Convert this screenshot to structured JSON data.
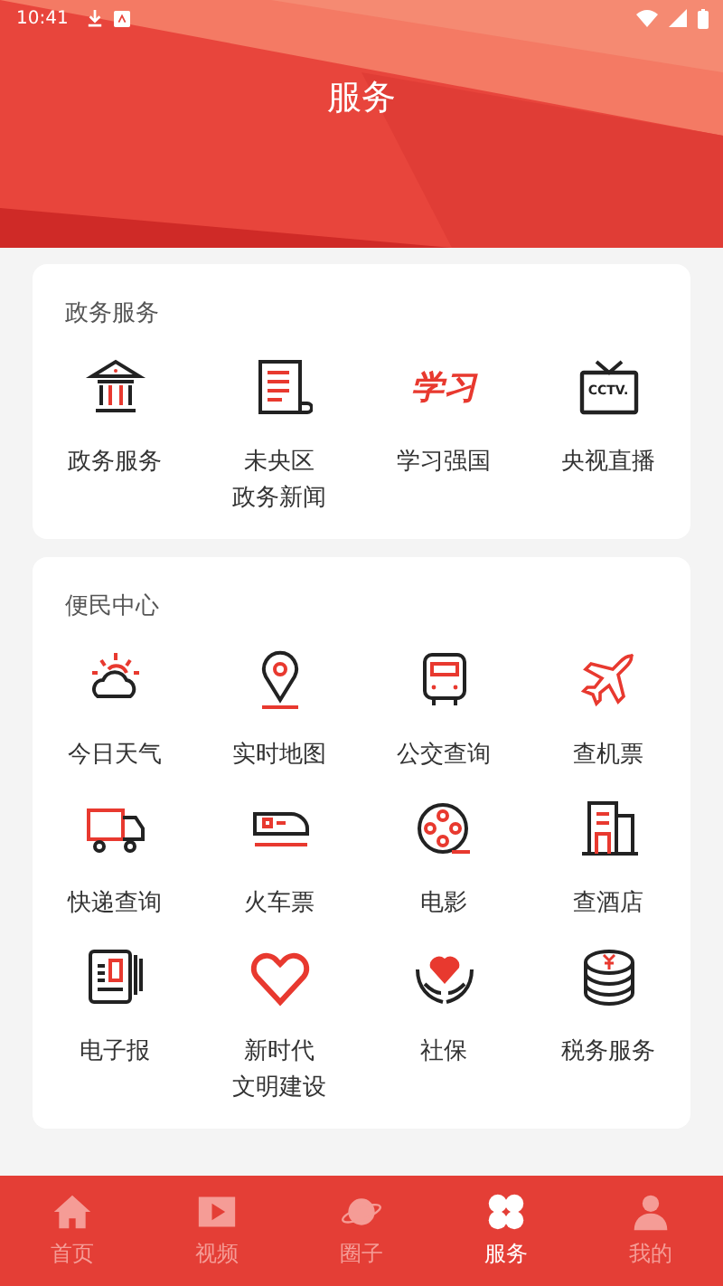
{
  "status_bar": {
    "time": "10:41"
  },
  "header": {
    "title": "服务"
  },
  "sections": [
    {
      "title": "政务服务",
      "items": [
        {
          "label": "政务服务"
        },
        {
          "label": "未央区",
          "label_line_2": "政务新闻"
        },
        {
          "label": "学习强国",
          "logo_text": "学习"
        },
        {
          "label": "央视直播",
          "logo_text": "CCTV."
        }
      ]
    },
    {
      "title": "便民中心",
      "items": [
        {
          "label": "今日天气"
        },
        {
          "label": "实时地图"
        },
        {
          "label": "公交查询"
        },
        {
          "label": "查机票"
        },
        {
          "label": "快递查询"
        },
        {
          "label": "火车票"
        },
        {
          "label": "电影"
        },
        {
          "label": "查酒店"
        },
        {
          "label": "电子报"
        },
        {
          "label": "新时代",
          "label_line_2": "文明建设"
        },
        {
          "label": "社保"
        },
        {
          "label": "税务服务"
        }
      ]
    }
  ],
  "tab_bar": [
    {
      "label": "首页",
      "selected": false
    },
    {
      "label": "视频",
      "selected": false
    },
    {
      "label": "圈子",
      "selected": false
    },
    {
      "label": "服务",
      "selected": true
    },
    {
      "label": "我的",
      "selected": false
    }
  ]
}
